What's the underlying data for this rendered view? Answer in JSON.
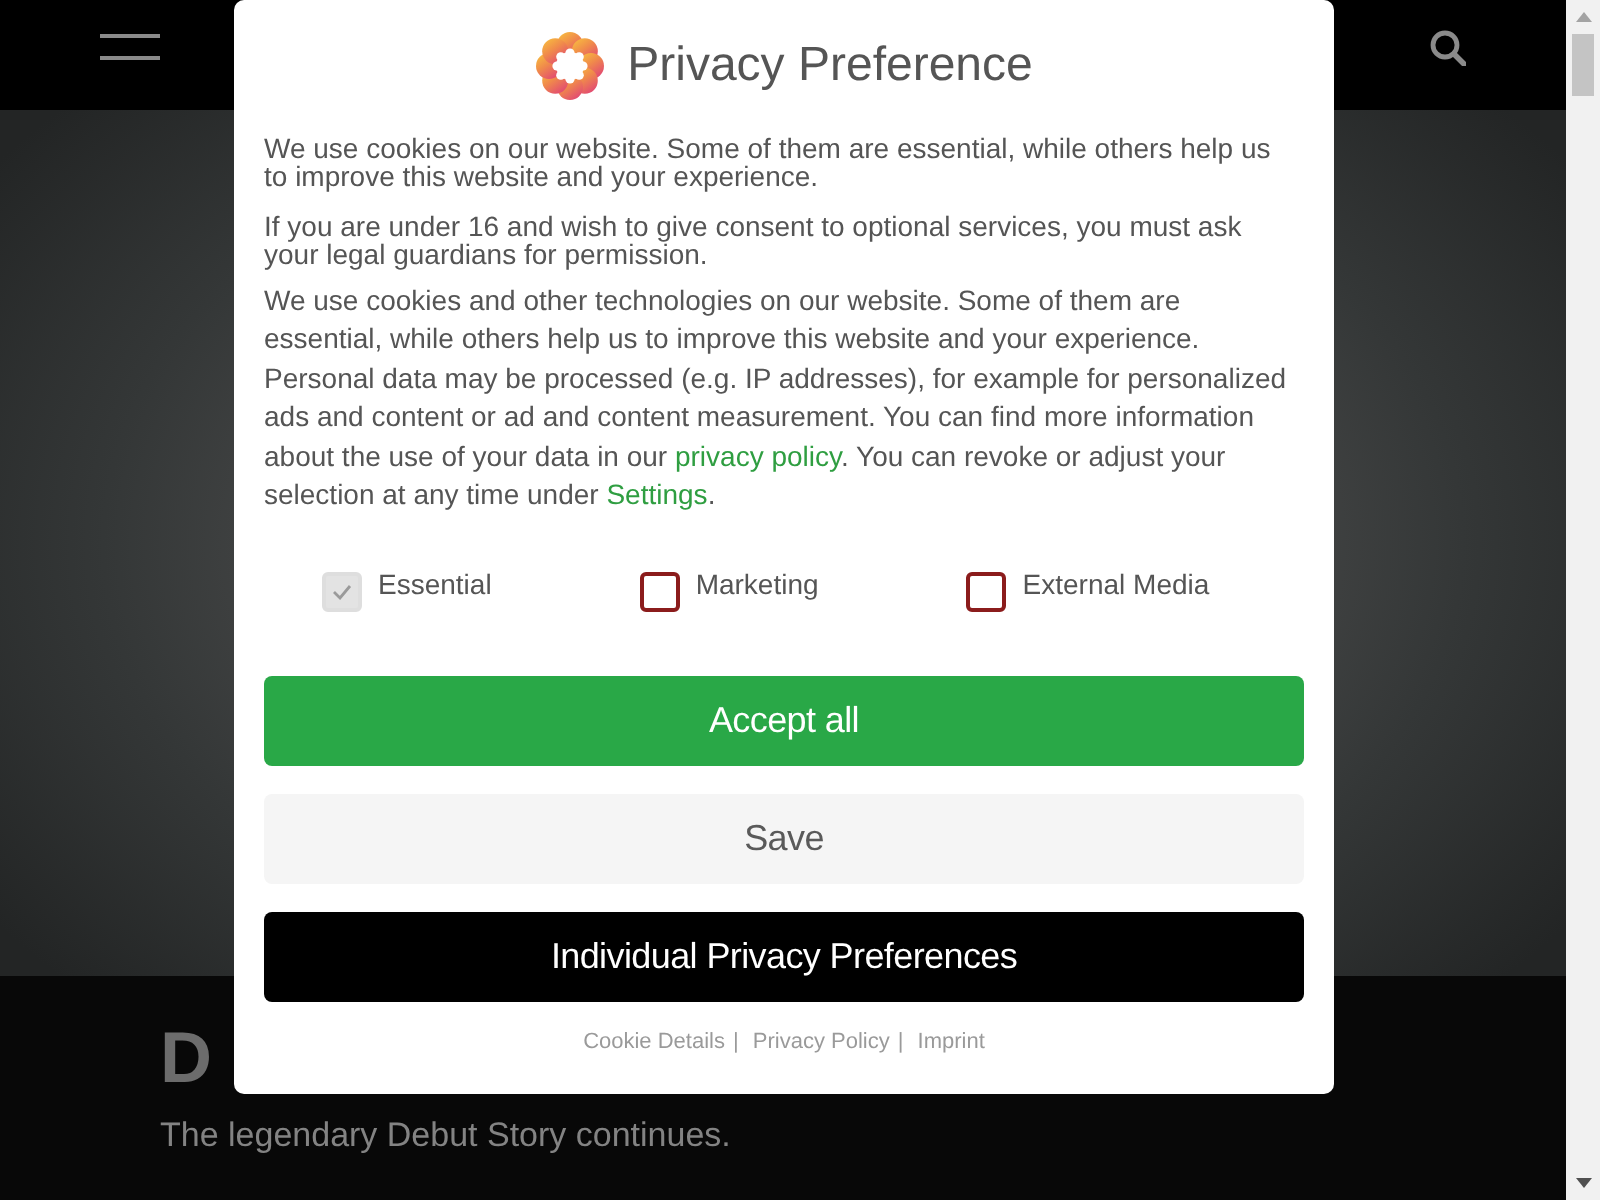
{
  "hero": {
    "heading": "D",
    "subtitle": "The legendary Debut Story continues."
  },
  "dialog": {
    "title": "Privacy Preference",
    "paragraphs": [
      {
        "kind": "notice",
        "parts": [
          {
            "kind": "text",
            "text": "We use cookies on our website. Some of them are essential, while others help us to improve this website and your experience."
          }
        ]
      },
      {
        "kind": "notice",
        "parts": [
          {
            "kind": "text",
            "text": "If you are under 16 and wish to give consent to optional services, you must ask your legal guardians for permission."
          }
        ]
      },
      {
        "kind": "details",
        "parts": [
          {
            "kind": "text",
            "text": "We use cookies and other technologies on our website. Some of them are essential, while others help us to improve this website and your experience. Personal data may be processed (e.g. IP addresses), for example for personalized ads and content or ad and content measurement. You can find more information about the use of your data in our "
          },
          {
            "kind": "link",
            "text": "privacy policy"
          },
          {
            "kind": "text",
            "text": ". You can revoke or adjust your selection at any time under "
          },
          {
            "kind": "link",
            "text": "Settings"
          },
          {
            "kind": "text",
            "text": "."
          }
        ]
      }
    ],
    "options": [
      {
        "label": "Essential",
        "checked": true,
        "disabled": true
      },
      {
        "label": "Marketing",
        "checked": false,
        "disabled": false
      },
      {
        "label": "External Media",
        "checked": false,
        "disabled": false
      }
    ],
    "buttons": [
      {
        "label": "Accept all",
        "kind": "accept"
      },
      {
        "label": "Save",
        "kind": "save"
      },
      {
        "label": "Individual Privacy Preferences",
        "kind": "preferences"
      }
    ],
    "footer": {
      "links": [
        "Cookie Details",
        "Privacy Policy",
        "Imprint"
      ],
      "separator": "|"
    }
  }
}
